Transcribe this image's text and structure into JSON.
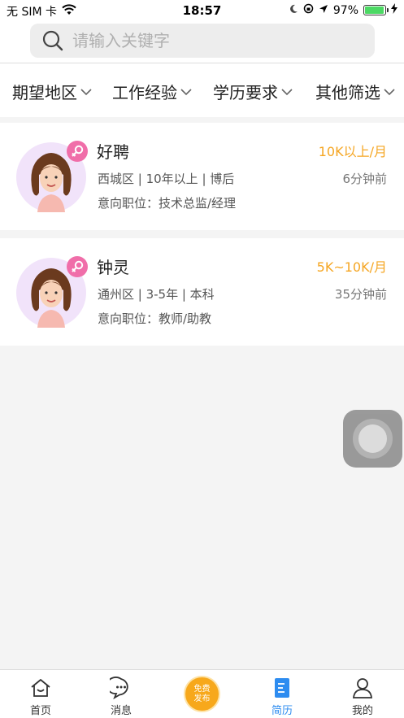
{
  "status_bar": {
    "carrier": "无 SIM 卡",
    "time": "18:57",
    "battery": "97%",
    "battery_level": 0.97
  },
  "search": {
    "placeholder": "请输入关键字"
  },
  "filters": [
    {
      "label": "期望地区"
    },
    {
      "label": "工作经验"
    },
    {
      "label": "学历要求"
    },
    {
      "label": "其他筛选"
    }
  ],
  "resumes": [
    {
      "name": "好聘",
      "salary": "10K以上/月",
      "meta": "西城区 | 10年以上 | 博后",
      "time": "6分钟前",
      "intent": "意向职位：技术总监/经理"
    },
    {
      "name": "钟灵",
      "salary": "5K~10K/月",
      "meta": "通州区 | 3-5年 | 本科",
      "time": "35分钟前",
      "intent": "意向职位：教师/助教"
    }
  ],
  "tabs": {
    "home": "首页",
    "messages": "消息",
    "publish_line1": "免费",
    "publish_line2": "发布",
    "resume": "简历",
    "mine": "我的"
  },
  "colors": {
    "salary": "#f5a623",
    "active_tab": "#2d8cf0",
    "female_badge": "#f06ea9",
    "publish_button": "#f7a81b"
  }
}
